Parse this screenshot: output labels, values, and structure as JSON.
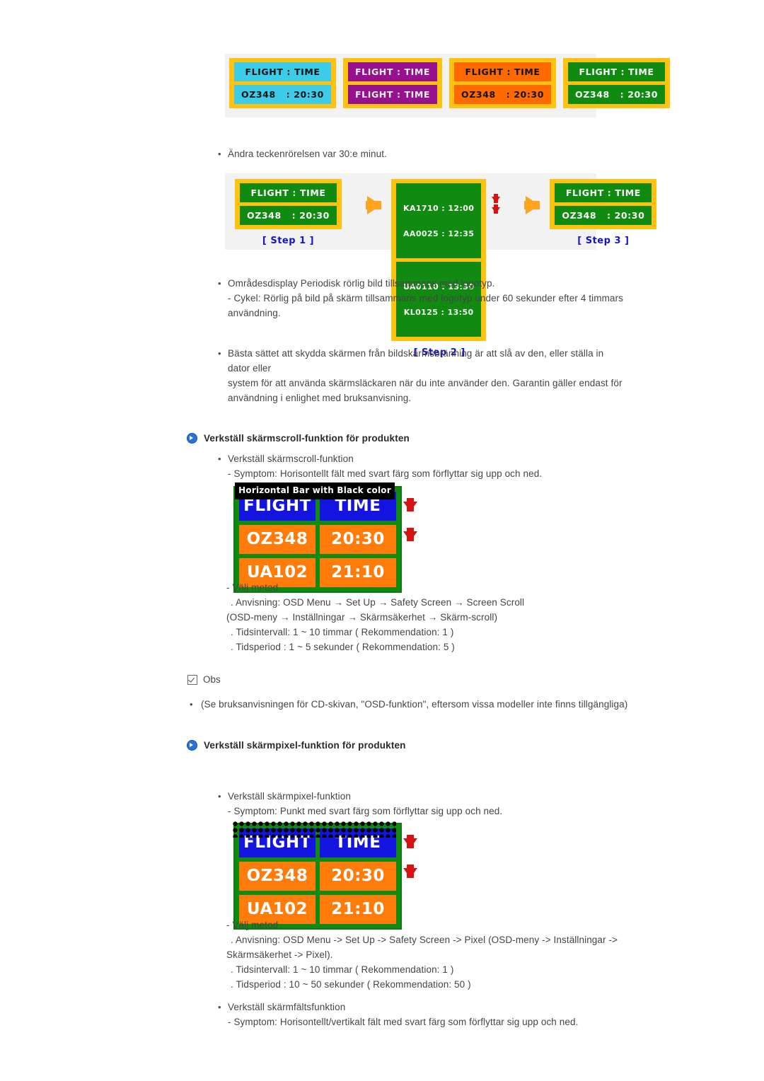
{
  "top_panels": [
    {
      "name": "cyan-panel",
      "style": "cyan",
      "line1": "FLIGHT : TIME",
      "line2": "OZ348   : 20:30"
    },
    {
      "name": "purple-panel",
      "style": "purple",
      "line1": "FLIGHT : TIME",
      "line2": "FLIGHT : TIME"
    },
    {
      "name": "orange-panel",
      "style": "orange",
      "line1": "FLIGHT : TIME",
      "line2": "OZ348   : 20:30"
    },
    {
      "name": "green-panel",
      "style": "green",
      "line1": "FLIGHT : TIME",
      "line2": "OZ348   : 20:30"
    }
  ],
  "char_move_note": "Ändra teckenrörelsen var 30:e minut.",
  "steps": {
    "step1": {
      "label": "[ Step 1 ]",
      "line1": "FLIGHT : TIME",
      "line2": "OZ348   : 20:30"
    },
    "step2": {
      "label": "[ Step 2 ]",
      "bar1_top": "KA1710 : 12:00",
      "bar1_bottom": "AA0025 : 12:35",
      "bar2_top": "UA0110 : 13:30",
      "bar2_bottom": "KL0125 : 13:50"
    },
    "step3": {
      "label": "[ Step 3 ]",
      "line1": "FLIGHT : TIME",
      "line2": "OZ348   : 20:30"
    }
  },
  "area_display": {
    "bullet": "Områdesdisplay Periodisk rörlig bild tillsammans med logotyp.",
    "line2": "- Cykel: Rörlig på bild på skärm tillsammans med logotyp under 60 sekunder efter 4 timmars",
    "line3": "användning."
  },
  "best_way": {
    "line1": "Bästa sättet att skydda skärmen från bildskärmsbränning är att slå av den, eller ställa in dator eller",
    "line2": "system för att använda skärmsläckaren när du inte använder den. Garantin gäller endast för",
    "line3": "användning i enlighet med bruksanvisning."
  },
  "scroll_section": {
    "heading": "Verkställ skärmscroll-funktion för produkten",
    "bullet": "Verkställ skärmscroll-funktion",
    "symptom": "- Symptom: Horisontellt fält med svart färg som förflyttar sig upp och ned.",
    "board": {
      "overlay_label": "Horizontal Bar with Black color",
      "cells": [
        "FLIGHT",
        "TIME",
        "OZ348",
        "20:30",
        "UA102",
        "21:10"
      ]
    },
    "method_lines": [
      "- Välj metod",
      ". Anvisning: OSD Menu → Set Up → Safety Screen → Screen Scroll",
      "(OSD-meny → Inställningar → Skärmsäkerhet → Skärm-scroll)",
      ". Tidsintervall: 1 ~ 10 timmar ( Rekommendation: 1 )",
      ". Tidsperiod : 1 ~ 5 sekunder ( Rekommendation: 5 )"
    ]
  },
  "note": {
    "label": "Obs",
    "bullet_mark": "•",
    "text": "(Se bruksanvisningen för CD-skivan, \"OSD-funktion\", eftersom vissa modeller inte finns tillgängliga)"
  },
  "pixel_section": {
    "heading": "Verkställ skärmpixel-funktion för produkten",
    "bullet": "Verkställ skärmpixel-funktion",
    "symptom": "- Symptom: Punkt med svart färg som förflyttar sig upp och ned.",
    "board": {
      "cells": [
        "FLIGHT",
        "TIME",
        "OZ348",
        "20:30",
        "UA102",
        "21:10"
      ]
    },
    "method_lines": [
      "- Välj metod",
      ". Anvisning: OSD Menu -> Set Up -> Safety Screen -> Pixel (OSD-meny -> Inställningar ->",
      "Skärmsäkerhet -> Pixel).",
      ". Tidsintervall: 1 ~ 10 timmar ( Rekommendation: 1 )",
      ". Tidsperiod : 10 ~ 50 sekunder ( Rekommendation: 50 )"
    ]
  },
  "field_section": {
    "bullet": "Verkställ skärmfältsfunktion",
    "symptom": "- Symptom: Horisontellt/vertikalt fält med svart färg som förflyttar sig upp och ned."
  },
  "colors": {
    "yellow_frame": "#FFC20E",
    "cyan": "#3CCBE8",
    "purple": "#97108D",
    "orange": "#FF6A00",
    "green": "#118A11",
    "blue_cell": "#1414E0",
    "orange_cell": "#FF7B0A",
    "red_arrow": "#D41313",
    "step_label_blue": "#1414C8",
    "accent_blue": "#2B72D6"
  }
}
